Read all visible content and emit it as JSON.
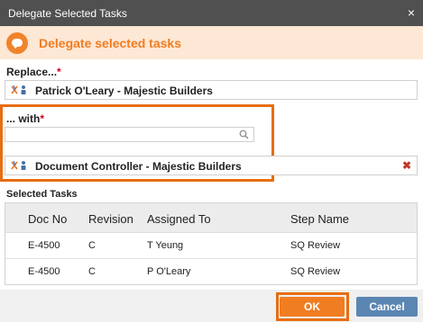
{
  "window": {
    "title": "Delegate Selected Tasks",
    "close_glyph": "×"
  },
  "banner": {
    "title": "Delegate selected tasks",
    "icon": "chat-bubble-icon"
  },
  "replace": {
    "label": "Replace...",
    "required_mark": "*",
    "selected": "Patrick O'Leary - Majestic Builders",
    "icon": "user-group-icon"
  },
  "with": {
    "label": "... with",
    "required_mark": "*",
    "search_value": "",
    "search_placeholder": "",
    "search_icon": "search-icon",
    "selected": "Document Controller - Majestic Builders",
    "remove_glyph": "✖",
    "icon": "user-group-icon"
  },
  "tasks": {
    "label": "Selected Tasks",
    "columns": [
      "Doc No",
      "Revision",
      "Assigned To",
      "Step Name"
    ],
    "rows": [
      [
        "E-4500",
        "C",
        "T Yeung",
        "SQ Review"
      ],
      [
        "E-4500",
        "C",
        "P O'Leary",
        "SQ Review"
      ]
    ]
  },
  "buttons": {
    "ok": "OK",
    "cancel": "Cancel"
  },
  "colors": {
    "accent_orange": "#f07d22",
    "highlight_border": "#e86d10",
    "title_bar": "#505050",
    "cancel_blue": "#5b86b2",
    "required_red": "#d0021b"
  }
}
